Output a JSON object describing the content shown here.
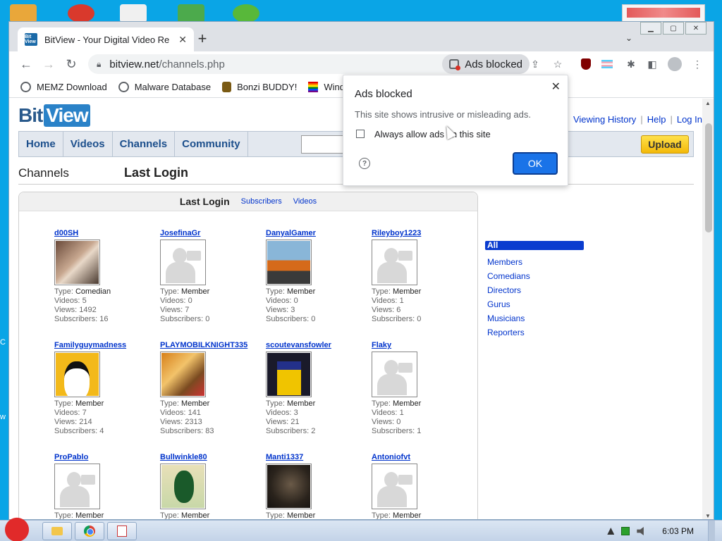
{
  "browser": {
    "tab_title": "BitView - Your Digital Video Re",
    "tab_favicon": "Bit View",
    "url_host": "bitview.net",
    "url_path": "/channels.php",
    "ads_chip_label": "Ads blocked",
    "bookmarks": [
      {
        "label": "MEMZ Download",
        "icon": "globe-icon"
      },
      {
        "label": "Malware Database",
        "icon": "globe-icon"
      },
      {
        "label": "Bonzi BUDDY!",
        "icon": "bonzi-icon"
      },
      {
        "label": "Wind",
        "icon": "rainbow-flag-icon"
      }
    ]
  },
  "popup": {
    "title": "Ads blocked",
    "message": "This site shows intrusive or misleading ads.",
    "checkbox_label": "Always allow ads on this site",
    "ok_label": "OK"
  },
  "site": {
    "logo_bit": "Bit",
    "logo_view": "View",
    "top_links": [
      "Viewing History",
      "Help",
      "Log In"
    ],
    "nav": [
      "Home",
      "Videos",
      "Channels",
      "Community"
    ],
    "upload_label": "Upload",
    "section_label": "Channels",
    "section_heading": "Last Login",
    "panel_tabs": {
      "active": "Last Login",
      "links": [
        "Subscribers",
        "Videos"
      ]
    },
    "stat_labels": {
      "type": "Type:",
      "videos": "Videos:",
      "views": "Views:",
      "subscribers": "Subscribers:"
    },
    "channels": [
      {
        "name": "d00SH",
        "type": "Comedian",
        "videos": "5",
        "views": "1492",
        "subscribers": "16",
        "thumb": "photo"
      },
      {
        "name": "JosefinaGr",
        "type": "Member",
        "videos": "0",
        "views": "7",
        "subscribers": "0",
        "thumb": "default"
      },
      {
        "name": "DanyalGamer",
        "type": "Member",
        "videos": "0",
        "views": "3",
        "subscribers": "0",
        "thumb": "car"
      },
      {
        "name": "Rileyboy1223",
        "type": "Member",
        "videos": "1",
        "views": "6",
        "subscribers": "0",
        "thumb": "default"
      },
      {
        "name": "Familyguymadness",
        "type": "Member",
        "videos": "7",
        "views": "214",
        "subscribers": "4",
        "thumb": "dog"
      },
      {
        "name": "PLAYMOBILKNIGHT335",
        "type": "Member",
        "videos": "141",
        "views": "2313",
        "subscribers": "83",
        "thumb": "toys"
      },
      {
        "name": "scoutevansfowler",
        "type": "Member",
        "videos": "3",
        "views": "21",
        "subscribers": "2",
        "thumb": "roblox"
      },
      {
        "name": "Flaky",
        "type": "Member",
        "videos": "1",
        "views": "0",
        "subscribers": "1",
        "thumb": "default"
      },
      {
        "name": "ProPablo",
        "type": "Member",
        "thumb": "default"
      },
      {
        "name": "Bullwinkle80",
        "type": "Member",
        "thumb": "penguin"
      },
      {
        "name": "Manti1337",
        "type": "Member",
        "thumb": "dark"
      },
      {
        "name": "Antoniofvt",
        "type": "Member",
        "thumb": "default"
      }
    ],
    "categories": [
      "All",
      "Members",
      "Comedians",
      "Directors",
      "Gurus",
      "Musicians",
      "Reporters"
    ]
  },
  "taskbar": {
    "clock": "6:03 PM"
  },
  "desktop": {
    "side_letters": [
      "C",
      "w"
    ]
  }
}
